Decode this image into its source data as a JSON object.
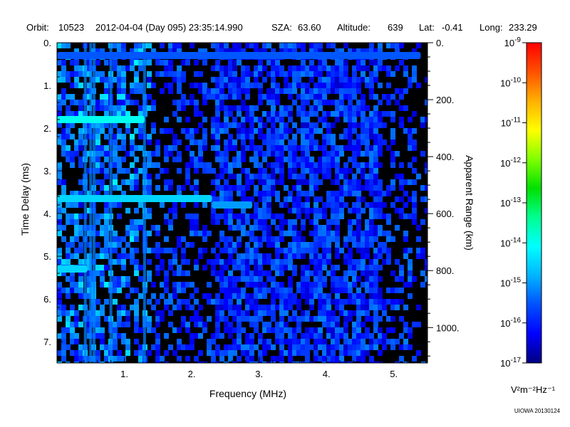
{
  "header": {
    "orbit_label": "Orbit:",
    "orbit": "10523",
    "datetime": "2012-04-04 (Day 095) 23:35:14.990",
    "sza_label": "SZA:",
    "sza": "63.60",
    "altitude_label": "Altitude:",
    "altitude": "639",
    "lat_label": "Lat:",
    "lat": "-0.41",
    "long_label": "Long:",
    "long": "233.29"
  },
  "credit": "UIOWA 20130124",
  "chart_data": {
    "type": "heatmap",
    "xlabel": "Frequency (MHz)",
    "ylabel": "Time Delay (ms)",
    "y2label": "Apparent Range (km)",
    "xlim": [
      0.0,
      5.5
    ],
    "ylim": [
      0.0,
      7.5
    ],
    "x_ticks": [
      1,
      2,
      3,
      4,
      5
    ],
    "x_tick_labels": [
      "1.",
      "2.",
      "3.",
      "4.",
      "5."
    ],
    "y_ticks": [
      0,
      1,
      2,
      3,
      4,
      5,
      6,
      7
    ],
    "y_tick_labels": [
      "0.",
      "1.",
      "2.",
      "3.",
      "4.",
      "5.",
      "6.",
      "7."
    ],
    "y2_ticks_km": [
      0,
      200,
      400,
      600,
      800,
      1000
    ],
    "y2_tick_labels": [
      "0.",
      "200.",
      "400.",
      "600.",
      "800.",
      "1000."
    ],
    "y2_km_per_ms": 149.9,
    "colorbar": {
      "unit_label": "V²m⁻²Hz⁻¹",
      "min_exp": -17,
      "max_exp": -9,
      "tick_base": "10",
      "tick_exponents": [
        "-9",
        "-10",
        "-11",
        "-12",
        "-13",
        "-14",
        "-15",
        "-16",
        "-17"
      ],
      "color_stops": [
        "#000080",
        "#0000ff",
        "#0050ff",
        "#00b4ff",
        "#00ffff",
        "#00ff90",
        "#00e000",
        "#80ff00",
        "#ffff00",
        "#ffb000",
        "#ff5000",
        "#ff0000"
      ]
    },
    "features": [
      {
        "name": "surface reflection band",
        "time_delay_ms": 0.3,
        "freq_range_mhz": [
          0.0,
          5.4
        ],
        "log_power": -15.5
      },
      {
        "name": "trace",
        "time_delay_ms": 1.8,
        "freq_range_mhz": [
          0.0,
          1.3
        ],
        "log_power": -14.0
      },
      {
        "name": "trace",
        "time_delay_ms": 3.65,
        "freq_range_mhz": [
          0.0,
          2.3
        ],
        "log_power": -14.5
      },
      {
        "name": "trace",
        "time_delay_ms": 3.8,
        "freq_range_mhz": [
          2.3,
          2.9
        ],
        "log_power": -15.0
      },
      {
        "name": "trace",
        "time_delay_ms": 5.3,
        "freq_range_mhz": [
          0.0,
          0.45
        ],
        "log_power": -14.5
      }
    ]
  }
}
